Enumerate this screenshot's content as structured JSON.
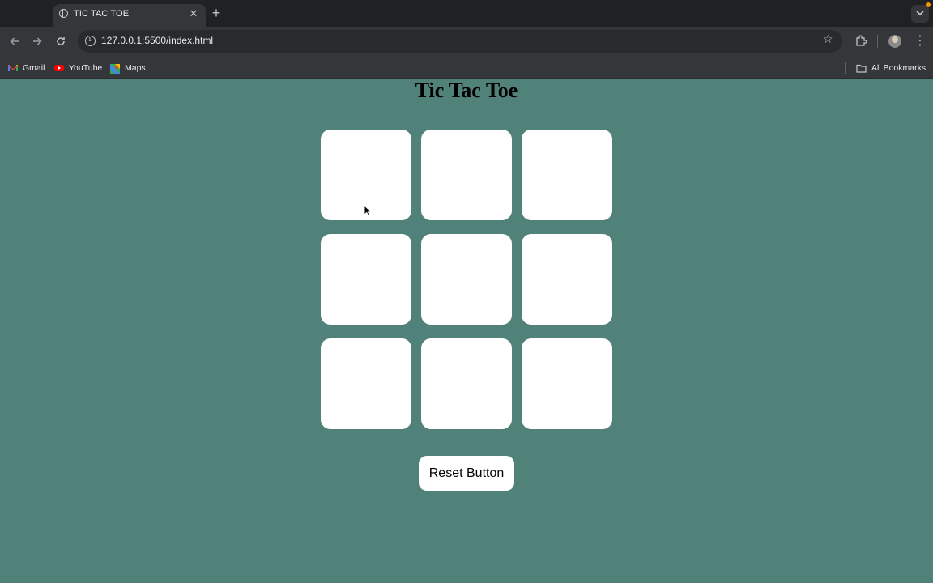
{
  "browser": {
    "tab": {
      "title": "TIC TAC TOE",
      "favicon": "globe-icon"
    },
    "address": {
      "url": "127.0.0.1:5500/index.html"
    },
    "bookmarks": [
      {
        "label": "Gmail",
        "icon": "gmail-icon"
      },
      {
        "label": "YouTube",
        "icon": "youtube-icon"
      },
      {
        "label": "Maps",
        "icon": "maps-icon"
      }
    ],
    "all_bookmarks_label": "All Bookmarks",
    "colors": {
      "chrome": "#202124",
      "toolbar": "#35363a",
      "omnibox": "#282a2d"
    }
  },
  "page": {
    "title": "Tic Tac Toe",
    "background": "#508279",
    "cells": [
      "",
      "",
      "",
      "",
      "",
      "",
      "",
      "",
      ""
    ],
    "reset_label": "Reset Button"
  }
}
